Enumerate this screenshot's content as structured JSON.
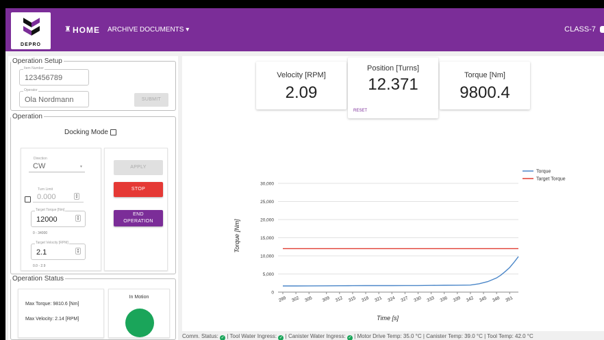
{
  "header": {
    "logo_text": "DEPRO",
    "home_label": "HOME",
    "nav_items": [
      "ARCHIVE",
      "DOCUMENTS ▾"
    ],
    "user": "CLASS-7"
  },
  "setup": {
    "title": "Operation Setup",
    "item_number_label": "Item Number",
    "item_number_value": "123456789",
    "operator_label": "Operator",
    "operator_value": "Ola Nordmann",
    "submit_label": "SUBMIT"
  },
  "operation": {
    "title": "Operation",
    "docking_mode_label": "Docking Mode",
    "direction_label": "Direction",
    "direction_value": "CW",
    "turn_limit_label": "Turn Limit",
    "turn_limit_value": "0.000",
    "target_torque_label": "Target Torque [Nm]",
    "target_torque_value": "12000",
    "target_torque_range": "0 - 34000",
    "target_velocity_label": "Target Velocity [RPM]",
    "target_velocity_value": "2.1",
    "target_velocity_range": "0.0 - 2.9",
    "apply_label": "APPLY",
    "stop_label": "STOP",
    "end_label_1": "END",
    "end_label_2": "OPERATION"
  },
  "status": {
    "title": "Operation Status",
    "max_torque": "Max Torque: 9810.6 [Nm]",
    "max_velocity": "Max Velocity: 2.14 [RPM]",
    "motion_label": "In Motion",
    "motion_color": "#1aa55a"
  },
  "metrics": {
    "velocity_title": "Velocity [RPM]",
    "velocity_value": "2.09",
    "position_title": "Position [Turns]",
    "position_value": "12.371",
    "reset_label": "RESET",
    "torque_title": "Torque [Nm]",
    "torque_value": "9800.4"
  },
  "chart_data": {
    "type": "line",
    "xlabel": "Time [s]",
    "ylabel": "Torque [Nm]",
    "ylim": [
      0,
      30000
    ],
    "yticks": [
      "0",
      "5,000",
      "10,000",
      "15,000",
      "20,000",
      "25,000",
      "30,000"
    ],
    "xticks": [
      "299",
      "302",
      "305",
      "309",
      "312",
      "315",
      "318",
      "321",
      "324",
      "327",
      "330",
      "333",
      "336",
      "339",
      "342",
      "345",
      "348",
      "351"
    ],
    "legend_position": "top-right",
    "grid": true,
    "series": [
      {
        "name": "Torque",
        "color": "#4a86c8",
        "x": [
          299,
          302,
          305,
          309,
          312,
          315,
          318,
          321,
          324,
          327,
          330,
          333,
          336,
          339,
          342,
          344,
          346,
          348,
          349,
          350,
          351,
          352,
          353
        ],
        "values": [
          1700,
          1700,
          1720,
          1740,
          1760,
          1780,
          1790,
          1800,
          1800,
          1810,
          1820,
          1850,
          1880,
          1900,
          1950,
          2300,
          2900,
          3900,
          4700,
          5700,
          6800,
          8200,
          9800
        ]
      },
      {
        "name": "Target Torque",
        "color": "#e03c31",
        "x": [
          299,
          353
        ],
        "values": [
          12000,
          12000
        ]
      }
    ]
  },
  "statusbar": {
    "comm": "Comm. Status:",
    "tool_water": "Tool Water Ingress:",
    "canister_water": "Canister Water Ingress:",
    "motor_temp": "Motor Drive Temp: 35.0 °C",
    "canister_temp": "Canister Temp: 39.0 °C",
    "tool_temp": "Tool Temp: 42.0 °C",
    "separator": "|",
    "ok_color": "#1aa55a"
  }
}
